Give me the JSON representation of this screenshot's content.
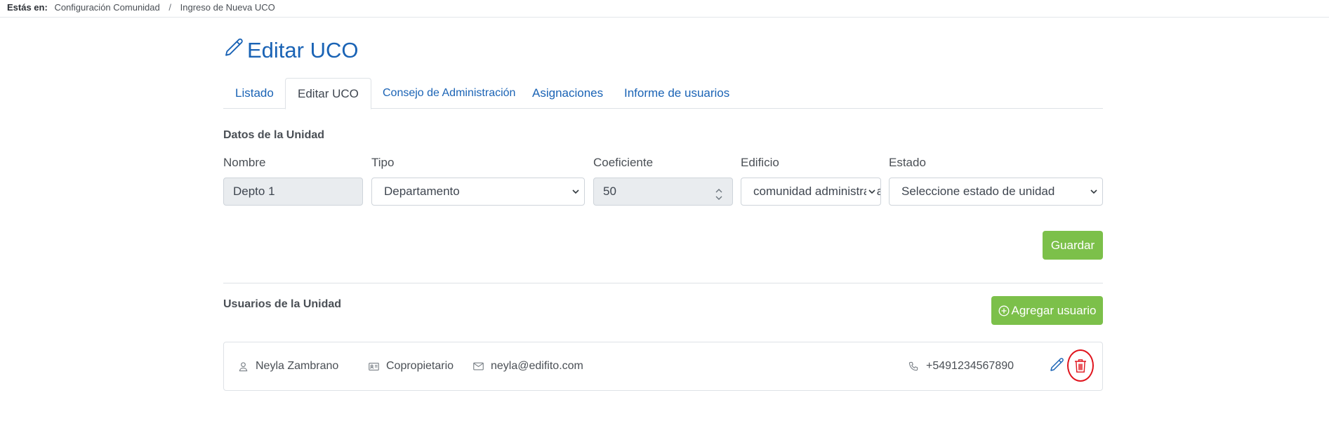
{
  "breadcrumb": {
    "label": "Estás en:",
    "items": [
      "Configuración Comunidad",
      "Ingreso de Nueva UCO"
    ],
    "separator": "/"
  },
  "page": {
    "title": "Editar UCO"
  },
  "tabs": [
    {
      "label": "Listado",
      "active": false
    },
    {
      "label": "Editar UCO",
      "active": true
    },
    {
      "label": "Consejo de Administración",
      "active": false
    },
    {
      "label": "Asignaciones",
      "active": false
    },
    {
      "label": "Informe de usuarios",
      "active": false
    }
  ],
  "unit": {
    "section_title": "Datos de la Unidad",
    "fields": {
      "nombre": {
        "label": "Nombre",
        "value": "Depto 1"
      },
      "tipo": {
        "label": "Tipo",
        "value": "Departamento"
      },
      "coeficiente": {
        "label": "Coeficiente",
        "value": "50"
      },
      "edificio": {
        "label": "Edificio",
        "value": "comunidad administrada"
      },
      "estado": {
        "label": "Estado",
        "value": "Seleccione estado de unidad"
      }
    },
    "save_label": "Guardar"
  },
  "users": {
    "section_title": "Usuarios de la Unidad",
    "add_label": "Agregar usuario",
    "list": [
      {
        "name": "Neyla Zambrano",
        "role": "Copropietario",
        "email": "neyla@edifito.com",
        "phone": "+5491234567890"
      }
    ]
  },
  "colors": {
    "primary": "#1a63b5",
    "success": "#7cc04a",
    "danger": "#e0141d",
    "border": "#dee2e6"
  },
  "icons": [
    "pencil-icon",
    "chevron-down-icon",
    "spinner-arrows-icon",
    "plus-circle-icon",
    "user-icon",
    "id-card-icon",
    "envelope-icon",
    "phone-icon",
    "trash-icon"
  ]
}
